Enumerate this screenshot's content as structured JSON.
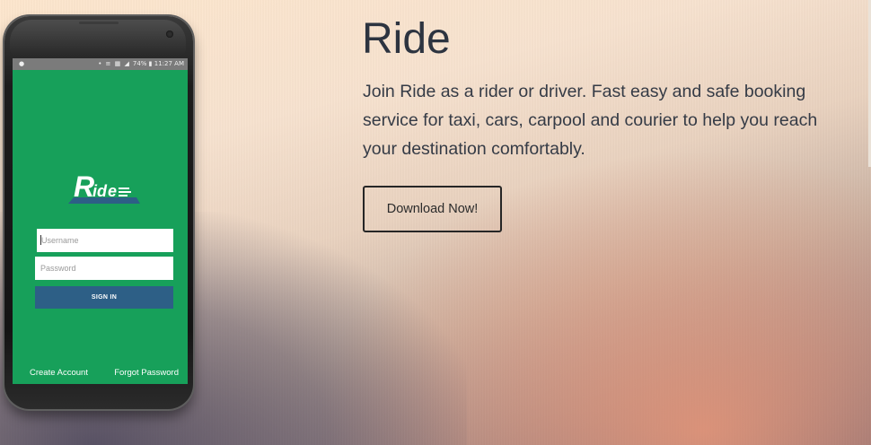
{
  "hero": {
    "title": "Ride",
    "description": "Join Ride as a rider or driver. Fast easy and safe booking service for taxi, cars, carpool and courier to help you reach your destination comfortably.",
    "download_label": "Download Now!"
  },
  "phone": {
    "status_bar": {
      "left_icon": "notification-icon",
      "icons": "mute-icon wifi-icon sim-icon signal-icon",
      "battery": "74%",
      "time": "11:27 AM"
    },
    "logo_text": "Ride",
    "username_placeholder": "Username",
    "password_placeholder": "Password",
    "signin_label": "SIGN IN",
    "create_account_label": "Create Account",
    "forgot_password_label": "Forgot Password"
  },
  "colors": {
    "app_green": "#17a05a",
    "signin_blue": "#2d5f86",
    "heading_text": "#2d3440",
    "button_border": "#262626"
  }
}
